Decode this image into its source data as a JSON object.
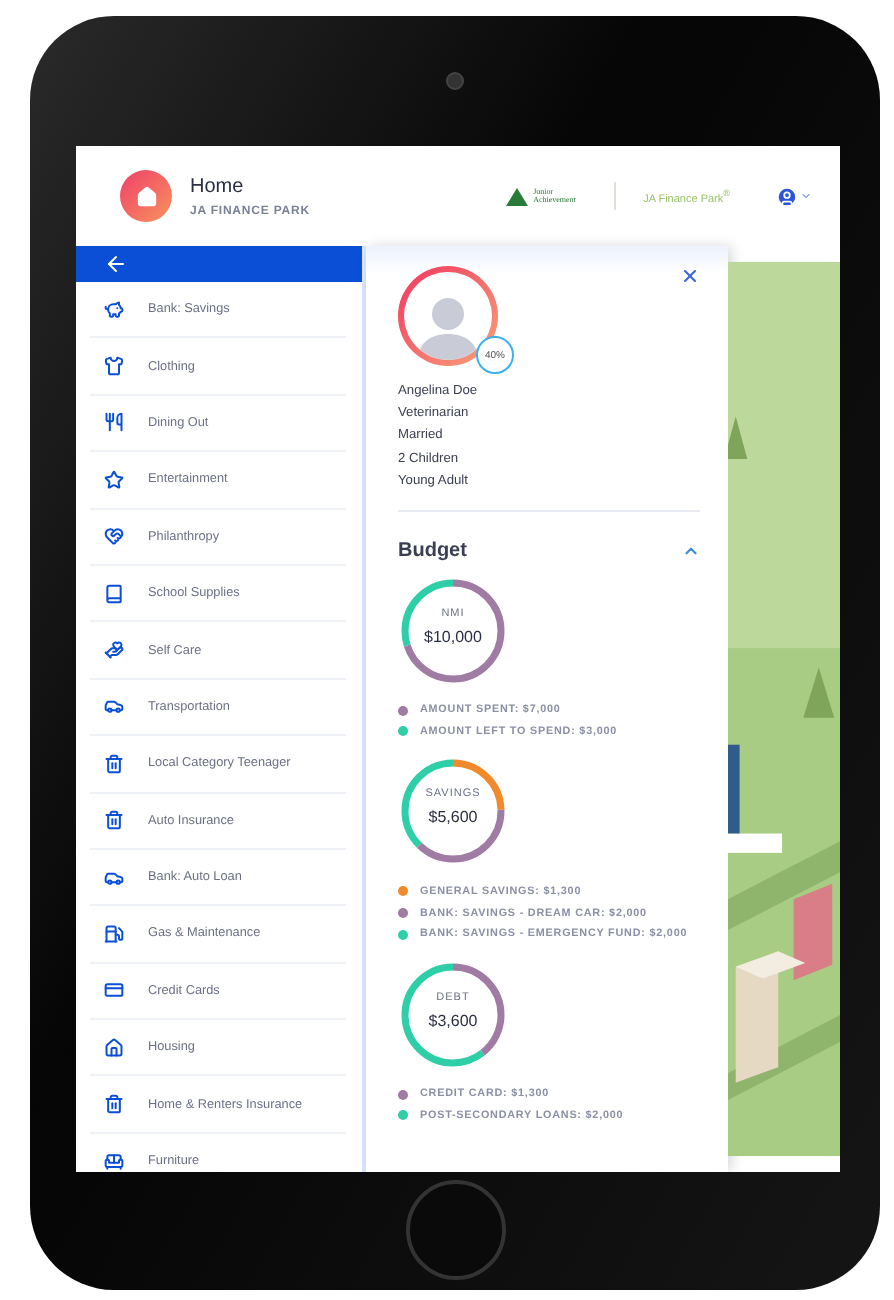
{
  "header": {
    "title": "Home",
    "subtitle": "JA FINANCE PARK",
    "logo_text": "Junior Achievement",
    "brand": "JA Finance Park$^{®}$"
  },
  "sidebar": {
    "items": [
      {
        "label": "Bank: Savings"
      },
      {
        "label": "Clothing"
      },
      {
        "label": "Dining Out"
      },
      {
        "label": "Entertainment"
      },
      {
        "label": "Philanthropy"
      },
      {
        "label": "School Supplies"
      },
      {
        "label": "Self Care"
      },
      {
        "label": "Transportation"
      },
      {
        "label": "Local Category Teenager"
      },
      {
        "label": "Auto Insurance"
      },
      {
        "label": "Bank: Auto Loan"
      },
      {
        "label": "Gas & Maintenance"
      },
      {
        "label": "Credit Cards"
      },
      {
        "label": "Housing"
      },
      {
        "label": "Home & Renters Insurance"
      },
      {
        "label": "Furniture"
      }
    ]
  },
  "profile": {
    "progress_badge": "40%",
    "details": [
      "Angelina Doe",
      "Veterinarian",
      "Married",
      "2 Children",
      "Young Adult"
    ]
  },
  "budget": {
    "title": "Budget",
    "expanded": true,
    "groups": [
      {
        "label": "NMI",
        "amount": "$10,000",
        "legend": [
          {
            "label": "AMOUNT SPENT: $7,000",
            "color": "#a07ba3"
          },
          {
            "label": "AMOUNT LEFT TO SPEND: $3,000",
            "color": "#2ecfa8"
          }
        ]
      },
      {
        "label": "SAVINGS",
        "amount": "$5,600",
        "legend": [
          {
            "label": "GENERAL SAVINGS: $1,300",
            "color": "#f08a2c"
          },
          {
            "label": "BANK: SAVINGS - DREAM CAR: $2,000",
            "color": "#a07ba3"
          },
          {
            "label": "BANK: SAVINGS - EMERGENCY FUND: $2,000",
            "color": "#2ecfa8"
          }
        ]
      },
      {
        "label": "DEBT",
        "amount": "$3,600",
        "legend": [
          {
            "label": "CREDIT CARD: $1,300",
            "color": "#a07ba3"
          },
          {
            "label": "POST-SECONDARY LOANS: $2,000",
            "color": "#2ecfa8"
          }
        ]
      }
    ]
  }
}
